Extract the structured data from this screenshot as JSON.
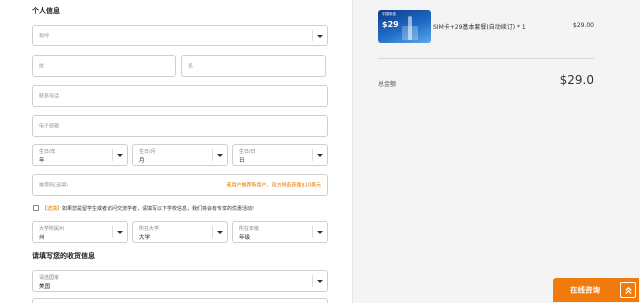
{
  "personal": {
    "title": "个人信息",
    "salutation": {
      "placeholder": "称呼"
    },
    "last_name": {
      "placeholder": "姓"
    },
    "first_name": {
      "placeholder": "名"
    },
    "phone": {
      "placeholder": "联系电话"
    },
    "email": {
      "placeholder": "电子邮箱"
    },
    "birth_year": {
      "label": "生日/年",
      "value": "年"
    },
    "birth_month": {
      "label": "生日/月",
      "value": "月"
    },
    "birth_day": {
      "label": "生日/日",
      "value": "日"
    },
    "referral": {
      "placeholder": "推荐码(选填)",
      "hint": "老用户推荐新用户，双方将各获赠$10美元"
    },
    "student": {
      "tag": "【选填】",
      "text": "如果您是留学生或者访问交流学者，请填写以下学校信息，我们将会有专享的优惠活动!"
    },
    "univ_state": {
      "label": "大学所属州",
      "value": "州"
    },
    "university": {
      "label": "所在大学",
      "value": "大学"
    },
    "grade": {
      "label": "所在年级",
      "value": "年级"
    }
  },
  "shipping": {
    "title": "请填写您的收货信息",
    "country": {
      "label": "请选国家",
      "value": "美国"
    }
  },
  "order": {
    "thumbnail": {
      "brand": "中国电信",
      "price_tag": "$29"
    },
    "product_name": "SIM卡+29基本套餐(自动续订) * 1",
    "product_price": "$29.00",
    "total_label": "总金额",
    "total_value": "$29.0"
  },
  "chat": {
    "label": "在线咨询"
  },
  "colors": {
    "accent": "#f07a0c",
    "border": "#cfcfcf",
    "panel": "#f4f4f4"
  }
}
